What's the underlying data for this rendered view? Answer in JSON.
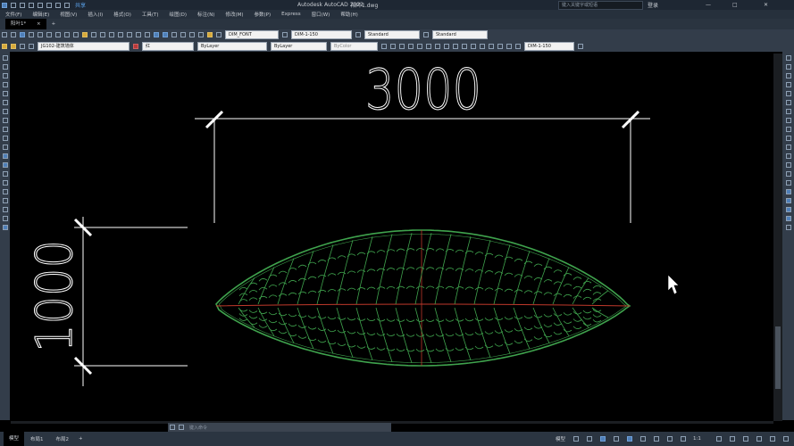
{
  "app": {
    "title": "Autodesk AutoCAD 2022",
    "filename": "阳叶1.dwg",
    "search_placeholder": "键入关键字或短语",
    "login": "登录",
    "share": "共享",
    "window_controls": [
      "—",
      "□",
      "✕"
    ]
  },
  "menu": [
    "文件(F)",
    "编辑(E)",
    "视图(V)",
    "插入(I)",
    "格式(O)",
    "工具(T)",
    "绘图(D)",
    "标注(N)",
    "修改(M)",
    "参数(P)",
    "Express",
    "窗口(W)",
    "帮助(H)"
  ],
  "tabs": {
    "active": "阳叶1*",
    "close": "×",
    "add": "+"
  },
  "toolbar": {
    "text_style": "DIM_FONT",
    "dim_style": "DIM-1-150",
    "table_style": "Standard",
    "multileader_style": "Standard",
    "layer": "JG102-建筑墙体",
    "color": "红",
    "linetype": "ByLayer",
    "lineweight": "ByLayer",
    "plotstyle": "ByColor",
    "dim_style_2": "DIM-1-150"
  },
  "drawing": {
    "horizontal_dim": "3000",
    "vertical_dim": "1000",
    "colors": {
      "dim": "#ffffff",
      "leaf": "#3fa34d",
      "midrib": "#c0392b",
      "background": "#000000"
    }
  },
  "command": {
    "placeholder": "键入命令"
  },
  "layout_tabs": [
    "模型",
    "布局1",
    "布局2"
  ],
  "status": {
    "model": "模型",
    "scale": "1:1"
  }
}
